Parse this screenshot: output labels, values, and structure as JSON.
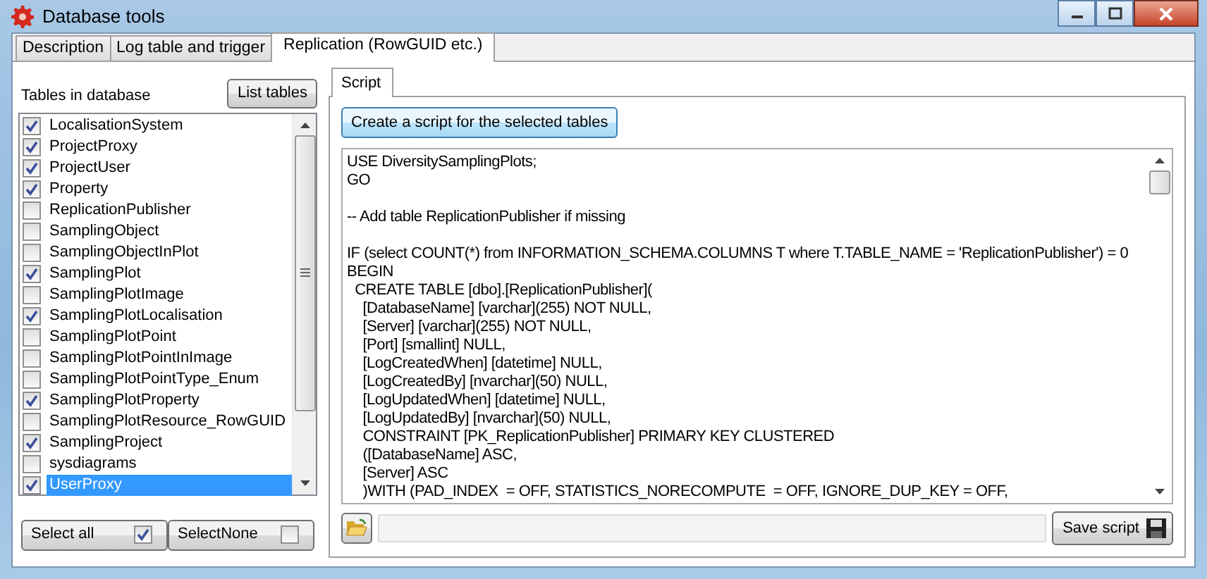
{
  "window": {
    "title": "Database tools"
  },
  "tabs": [
    {
      "label": "Description",
      "selected": false
    },
    {
      "label": "Log table and trigger",
      "selected": false
    },
    {
      "label": "Replication (RowGUID etc.)",
      "selected": true
    }
  ],
  "tables_panel": {
    "label": "Tables in database",
    "list_button": "List tables",
    "tables": [
      {
        "name": "LocalisationSystem",
        "checked": true,
        "selected": false
      },
      {
        "name": "ProjectProxy",
        "checked": true,
        "selected": false
      },
      {
        "name": "ProjectUser",
        "checked": true,
        "selected": false
      },
      {
        "name": "Property",
        "checked": true,
        "selected": false
      },
      {
        "name": "ReplicationPublisher",
        "checked": false,
        "selected": false
      },
      {
        "name": "SamplingObject",
        "checked": false,
        "selected": false
      },
      {
        "name": "SamplingObjectInPlot",
        "checked": false,
        "selected": false
      },
      {
        "name": "SamplingPlot",
        "checked": true,
        "selected": false
      },
      {
        "name": "SamplingPlotImage",
        "checked": false,
        "selected": false
      },
      {
        "name": "SamplingPlotLocalisation",
        "checked": true,
        "selected": false
      },
      {
        "name": "SamplingPlotPoint",
        "checked": false,
        "selected": false
      },
      {
        "name": "SamplingPlotPointInImage",
        "checked": false,
        "selected": false
      },
      {
        "name": "SamplingPlotPointType_Enum",
        "checked": false,
        "selected": false
      },
      {
        "name": "SamplingPlotProperty",
        "checked": true,
        "selected": false
      },
      {
        "name": "SamplingPlotResource_RowGUID",
        "checked": false,
        "selected": false
      },
      {
        "name": "SamplingProject",
        "checked": true,
        "selected": false
      },
      {
        "name": "sysdiagrams",
        "checked": false,
        "selected": false
      },
      {
        "name": "UserProxy",
        "checked": true,
        "selected": true
      }
    ],
    "select_all": {
      "label": "Select all",
      "checked": true
    },
    "select_none": {
      "label": "SelectNone",
      "checked": false
    }
  },
  "script_panel": {
    "tabs": [
      {
        "label": "Script",
        "selected": true
      }
    ],
    "create_button": "Create a script for the selected tables",
    "script": "USE DiversitySamplingPlots;\nGO\n\n-- Add table ReplicationPublisher if missing\n\nIF (select COUNT(*) from INFORMATION_SCHEMA.COLUMNS T where T.TABLE_NAME = 'ReplicationPublisher') = 0\nBEGIN\n  CREATE TABLE [dbo].[ReplicationPublisher](\n    [DatabaseName] [varchar](255) NOT NULL,\n    [Server] [varchar](255) NOT NULL,\n    [Port] [smallint] NULL,\n    [LogCreatedWhen] [datetime] NULL,\n    [LogCreatedBy] [nvarchar](50) NULL,\n    [LogUpdatedWhen] [datetime] NULL,\n    [LogUpdatedBy] [nvarchar](50) NULL,\n    CONSTRAINT [PK_ReplicationPublisher] PRIMARY KEY CLUSTERED\n    ([DatabaseName] ASC,\n    [Server] ASC\n    )WITH (PAD_INDEX  = OFF, STATISTICS_NORECOMPUTE  = OFF, IGNORE_DUP_KEY = OFF,",
    "save_button": "Save script"
  }
}
